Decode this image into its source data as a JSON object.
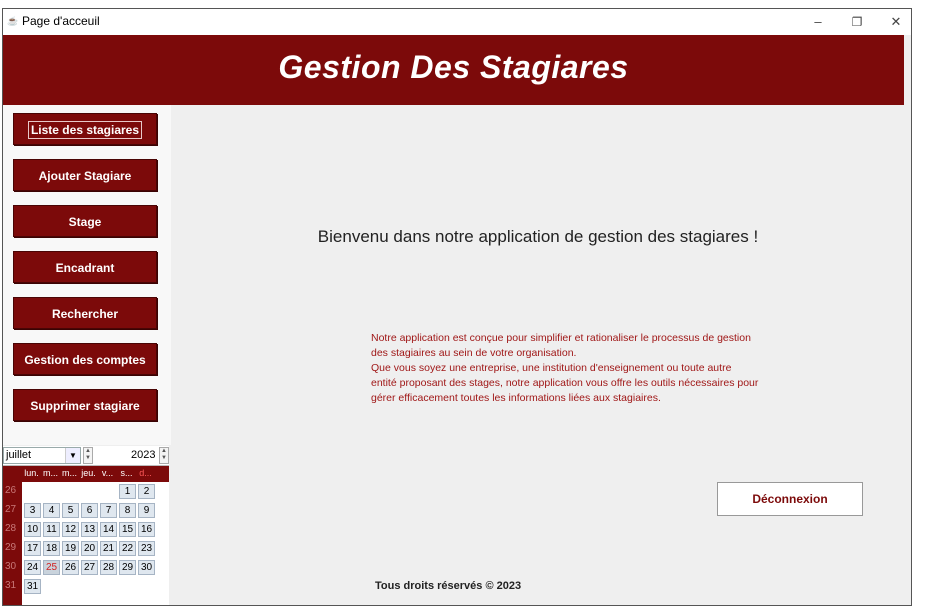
{
  "window": {
    "title": "Page d'acceuil",
    "icon": "java-cup-icon",
    "controls": {
      "minimize": "–",
      "maximize": "❐",
      "close": "✕"
    }
  },
  "header": {
    "title": "Gestion Des Stagiares"
  },
  "sidebar": {
    "items": [
      {
        "label": "Liste des stagiares"
      },
      {
        "label": "Ajouter Stagiare"
      },
      {
        "label": "Stage"
      },
      {
        "label": "Encadrant"
      },
      {
        "label": "Rechercher"
      },
      {
        "label": "Gestion des comptes"
      },
      {
        "label": "Supprimer stagiare"
      }
    ]
  },
  "calendar": {
    "month": "juillet",
    "year": "2023",
    "weekdays": [
      "lun.",
      "m...",
      "m...",
      "jeu.",
      "v...",
      "s...",
      "d..."
    ],
    "week_numbers": [
      "26",
      "27",
      "28",
      "29",
      "30",
      "31"
    ],
    "days": [
      [
        "",
        "",
        "",
        "",
        "",
        "1",
        "2"
      ],
      [
        "3",
        "4",
        "5",
        "6",
        "7",
        "8",
        "9"
      ],
      [
        "10",
        "11",
        "12",
        "13",
        "14",
        "15",
        "16"
      ],
      [
        "17",
        "18",
        "19",
        "20",
        "21",
        "22",
        "23"
      ],
      [
        "24",
        "25",
        "26",
        "27",
        "28",
        "29",
        "30"
      ],
      [
        "31",
        "",
        "",
        "",
        "",
        "",
        ""
      ]
    ],
    "today": "25"
  },
  "main": {
    "welcome": "Bienvenu dans notre application de gestion des stagiares !",
    "description_lines": [
      "Notre application est conçue pour simplifier et rationaliser le processus de gestion",
      "des stagiaires au sein de votre organisation.",
      "Que vous soyez une entreprise, une institution d'enseignement ou toute autre",
      "entité proposant des stages, notre application vous offre les outils nécessaires pour",
      "gérer efficacement toutes les informations liées aux stagiaires."
    ],
    "logout_label": "Déconnexion",
    "footer": "Tous droits réservés © 2023"
  },
  "colors": {
    "brand": "#7c0a0a",
    "description_text": "#a01818",
    "today_text": "#d02020"
  }
}
